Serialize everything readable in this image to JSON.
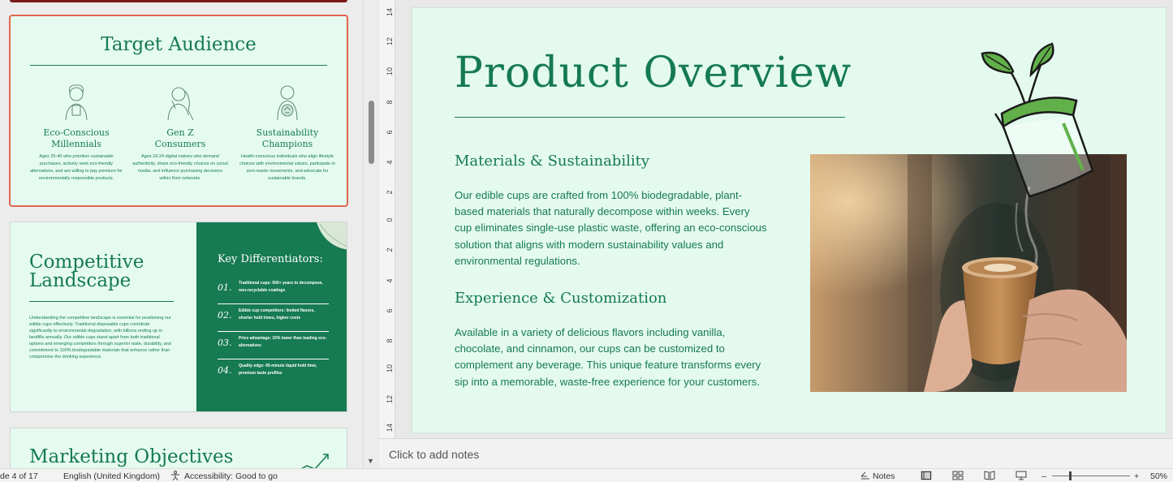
{
  "thumbnails": {
    "slide3": {
      "title": "Target Audience",
      "audiences": [
        {
          "name_line1": "Eco-Conscious",
          "name_line2": "Millennials",
          "desc": "Ages 25-40 who prioritize sustainable purchases, actively seek eco-friendly alternatives, and are willing to pay premium for environmentally responsible products."
        },
        {
          "name_line1": "Gen Z",
          "name_line2": "Consumers",
          "desc": "Ages 18-24 digital natives who demand authenticity, share eco-friendly choices on social media, and influence purchasing decisions within their networks."
        },
        {
          "name_line1": "Sustainability",
          "name_line2": "Champions",
          "desc": "Health-conscious individuals who align lifestyle choices with environmental values, participate in zero-waste movements, and advocate for sustainable brands."
        }
      ]
    },
    "slide4": {
      "title_line1": "Competitive",
      "title_line2": "Landscape",
      "body": "Understanding the competitive landscape is essential for positioning our edible cups effectively. Traditional disposable cups contribute significantly to environmental degradation, with billions ending up in landfills annually. Our edible cups stand apart from both traditional options and emerging competitors through superior taste, durability, and commitment to 100% biodegradable materials that enhance rather than compromise the drinking experience.",
      "key_title": "Key Differentiators:",
      "differentiators": [
        {
          "num": "01.",
          "text": "Traditional cups: 500+ years to decompose, non-recyclable coatings"
        },
        {
          "num": "02.",
          "text": "Edible cup competitors: limited flavors, shorter hold times, higher costs"
        },
        {
          "num": "03.",
          "text": "Price advantage: 15% lower than leading eco-alternatives"
        },
        {
          "num": "04.",
          "text": "Quality edge: 45-minute liquid hold time, premium taste profiles"
        }
      ]
    },
    "slide5": {
      "title": "Marketing Objectives"
    }
  },
  "ruler": {
    "labels": [
      "14",
      "12",
      "10",
      "8",
      "6",
      "4",
      "2",
      "0",
      "2",
      "4",
      "6",
      "8",
      "10",
      "12",
      "14"
    ]
  },
  "slide": {
    "heading": "Product Overview",
    "section1_title": "Materials & Sustainability",
    "section1_body": "Our edible cups are crafted from 100% biodegradable, plant-based materials that naturally decompose within weeks. Every cup eliminates single-use plastic waste, offering an eco-conscious solution that aligns with modern sustainability values and environmental regulations.",
    "section2_title": "Experience & Customization",
    "section2_body": "Available in a variety of delicious flavors including vanilla, chocolate, and cinnamon, our cups can be customized to complement any beverage. This unique feature transforms every sip into a memorable, waste-free experience for your customers."
  },
  "notes": {
    "placeholder": "Click to add notes"
  },
  "status": {
    "slide_counter": "de 4 of 17",
    "language": "English (United Kingdom)",
    "accessibility": "Accessibility: Good to go",
    "notes_label": "Notes",
    "zoom_minus": "–",
    "zoom_plus": "+",
    "zoom": "50%"
  },
  "colors": {
    "brand_green": "#157a52",
    "slide_bg": "#e4faee",
    "selection": "#e0664d"
  }
}
